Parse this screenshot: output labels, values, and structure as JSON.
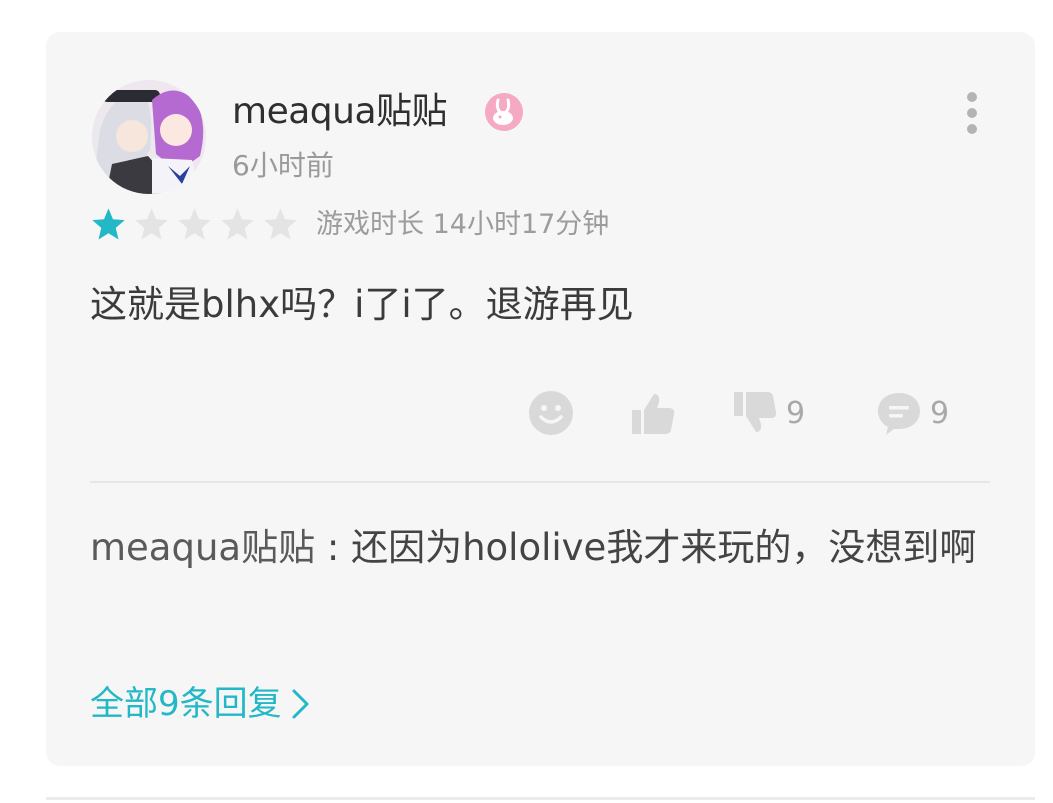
{
  "review": {
    "username": "meaqua贴贴",
    "time_ago": "6小时前",
    "rating": 1,
    "rating_max": 5,
    "playtime": "游戏时长 14小时17分钟",
    "content": "这就是blhx吗？i了i了。退游再见",
    "actions": {
      "emoji_icon": "smiley-icon",
      "like_icon": "thumbs-up-icon",
      "dislike_icon": "thumbs-down-icon",
      "dislike_count": "9",
      "comment_icon": "comment-icon",
      "comment_count": "9"
    }
  },
  "reply": {
    "username": "meaqua贴贴",
    "separator": " : ",
    "text": "还因为hololive我才来玩的，没想到啊"
  },
  "all_replies_link": "全部9条回复",
  "colors": {
    "accent": "#22b8c6",
    "star_filled": "#22b8c6",
    "star_empty": "#e4e4e4",
    "card_bg": "#f6f6f6",
    "icon_gray": "#d6d6d6"
  }
}
